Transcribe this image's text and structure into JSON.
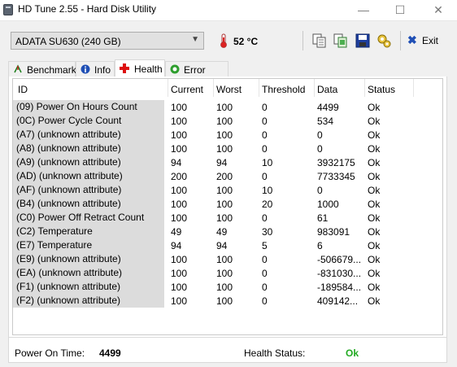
{
  "window": {
    "title": "HD Tune 2.55 - Hard Disk Utility",
    "min_glyph": "—",
    "max_glyph": "☐",
    "close_glyph": "✕"
  },
  "toolbar": {
    "drive": "ADATA   SU630 (240 GB)",
    "temperature": "52 °C",
    "exit_label": "Exit"
  },
  "tabs": [
    {
      "label": "Benchmark"
    },
    {
      "label": "Info"
    },
    {
      "label": "Health"
    },
    {
      "label": "Error Scan"
    }
  ],
  "table": {
    "headers": [
      "ID",
      "Current",
      "Worst",
      "Threshold",
      "Data",
      "Status"
    ],
    "rows": [
      [
        "(09) Power On Hours Count",
        "100",
        "100",
        "0",
        "4499",
        "Ok"
      ],
      [
        "(0C) Power Cycle Count",
        "100",
        "100",
        "0",
        "534",
        "Ok"
      ],
      [
        "(A7) (unknown attribute)",
        "100",
        "100",
        "0",
        "0",
        "Ok"
      ],
      [
        "(A8) (unknown attribute)",
        "100",
        "100",
        "0",
        "0",
        "Ok"
      ],
      [
        "(A9) (unknown attribute)",
        "94",
        "94",
        "10",
        "3932175",
        "Ok"
      ],
      [
        "(AD) (unknown attribute)",
        "200",
        "200",
        "0",
        "7733345",
        "Ok"
      ],
      [
        "(AF) (unknown attribute)",
        "100",
        "100",
        "10",
        "0",
        "Ok"
      ],
      [
        "(B4) (unknown attribute)",
        "100",
        "100",
        "20",
        "1000",
        "Ok"
      ],
      [
        "(C0) Power Off Retract Count",
        "100",
        "100",
        "0",
        "61",
        "Ok"
      ],
      [
        "(C2) Temperature",
        "49",
        "49",
        "30",
        "983091",
        "Ok"
      ],
      [
        "(E7) Temperature",
        "94",
        "94",
        "5",
        "6",
        "Ok"
      ],
      [
        "(E9) (unknown attribute)",
        "100",
        "100",
        "0",
        "-506679...",
        "Ok"
      ],
      [
        "(EA) (unknown attribute)",
        "100",
        "100",
        "0",
        "-831030...",
        "Ok"
      ],
      [
        "(F1) (unknown attribute)",
        "100",
        "100",
        "0",
        "-189584...",
        "Ok"
      ],
      [
        "(F2) (unknown attribute)",
        "100",
        "100",
        "0",
        "409142...",
        "Ok"
      ]
    ]
  },
  "footer": {
    "power_on_label": "Power On Time:",
    "power_on_value": "4499",
    "health_label": "Health Status:",
    "health_value": "Ok",
    "health_color": "#22aa22"
  }
}
